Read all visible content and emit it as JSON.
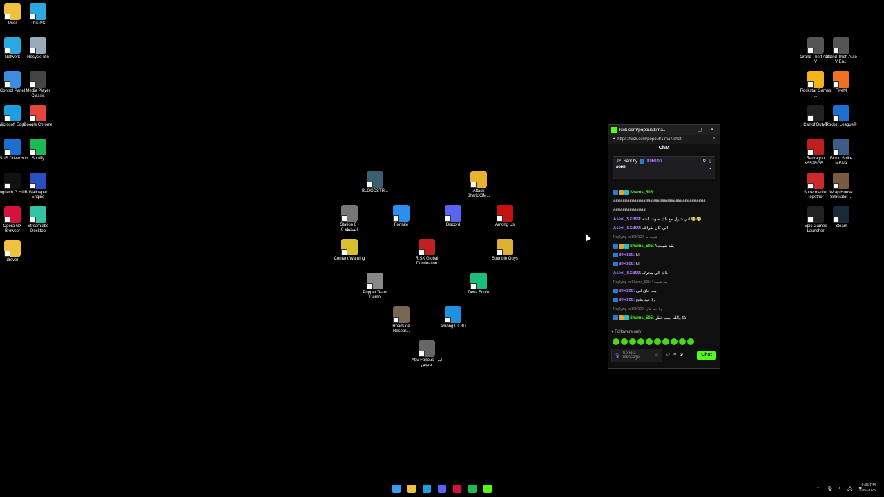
{
  "desktop_left": [
    {
      "label": "User",
      "color": "#f0c040"
    },
    {
      "label": "This PC",
      "color": "#2aa9e0"
    },
    {
      "label": "Network",
      "color": "#2aa9e0"
    },
    {
      "label": "Recycle Bin",
      "color": "#9ab"
    },
    {
      "label": "Control Panel",
      "color": "#3c8de0"
    },
    {
      "label": "Media Player Classic",
      "color": "#444"
    },
    {
      "label": "Microsoft Edge",
      "color": "#1e9de0"
    },
    {
      "label": "Google Chrome",
      "color": "#e4453a"
    },
    {
      "label": "ASUS DriverHub",
      "color": "#1a6fd0"
    },
    {
      "label": "Spotify",
      "color": "#1db954"
    },
    {
      "label": "Logitech G HUB",
      "color": "#111"
    },
    {
      "label": "Wallpaper Engine",
      "color": "#2a4fc0"
    },
    {
      "label": "Opera GX Browser",
      "color": "#d4123c"
    },
    {
      "label": "Streamlabs Desktop",
      "color": "#31c3a2"
    },
    {
      "label": "drover",
      "color": "#f0c040"
    }
  ],
  "desktop_center": [
    {
      "label": "BLOODSTR...",
      "color": "#3a6070"
    },
    {
      "label": "Attack SharkX8M...",
      "color": "#e8b22c"
    },
    {
      "label": "Station 0 - المحطة 0",
      "color": "#777"
    },
    {
      "label": "Fortnite",
      "color": "#2a8ff0"
    },
    {
      "label": "Discord",
      "color": "#5865f2"
    },
    {
      "label": "Among Us",
      "color": "#c51111"
    },
    {
      "label": "Content Warning",
      "color": "#d8c030"
    },
    {
      "label": "RISK Global Domination",
      "color": "#c02020"
    },
    {
      "label": "Stumble Guys",
      "color": "#e0b030"
    },
    {
      "label": "Puppet Team Demo",
      "color": "#888"
    },
    {
      "label": "Delta Force",
      "color": "#1bbf7a"
    },
    {
      "label": "Roadside Resear...",
      "color": "#776655"
    },
    {
      "label": "Among Us 3D",
      "color": "#2090e0"
    },
    {
      "label": "Abu Fanous - ابو فانوس",
      "color": "#666"
    }
  ],
  "desktop_right": [
    {
      "label": "Grand Theft Auto V",
      "color": "#555"
    },
    {
      "label": "Grand Theft Auto V En...",
      "color": "#555"
    },
    {
      "label": "Rockstar Games ...",
      "color": "#f3b41a"
    },
    {
      "label": "FiveM",
      "color": "#f07020"
    },
    {
      "label": "Call of Duty®",
      "color": "#222"
    },
    {
      "label": "Rocket League®",
      "color": "#1f6fd0"
    },
    {
      "label": "Redragon K552RGB...",
      "color": "#c21e1e"
    },
    {
      "label": "Blood Strike MENA",
      "color": "#3e5c88"
    },
    {
      "label": "Supermarket Together",
      "color": "#d02828"
    },
    {
      "label": "Wrap House Simulator ...",
      "color": "#7a5a40"
    },
    {
      "label": "Epic Games Launcher",
      "color": "#222"
    },
    {
      "label": "Steam",
      "color": "#1b2838"
    }
  ],
  "popup": {
    "title": "kick.com/popout/1ima...",
    "url": "https://kick.com/popout/1ima7/chat",
    "chat_header": "Chat",
    "pinned": {
      "sent_by": "Sent by",
      "user": "89H100",
      "text": "89H1"
    },
    "messages": [
      {
        "user": "Shams_505:",
        "text": "",
        "user_color": "green",
        "badges": true
      },
      {
        "user": "",
        "text": "########################################",
        "user_color": "none"
      },
      {
        "user": "",
        "text": "##############",
        "user_color": "none"
      },
      {
        "user": "Aseel_SXB99:",
        "text": "اني جيرل مع ناك صوت انحه 😂😂",
        "user_color": "purple"
      },
      {
        "user": "Aseel_SXB99:",
        "text": "الي كان يقرانك",
        "user_color": "purple"
      },
      {
        "reply": "Replying to 89H100: شبيت يد"
      },
      {
        "user": "Shams_505:",
        "text": "يقد شبيت؟",
        "user_color": "green",
        "badges": true
      },
      {
        "user": "89H100:",
        "text": "انا",
        "user_color": "purple"
      },
      {
        "user": "89H100:",
        "text": "انا",
        "user_color": "purple"
      },
      {
        "user": "Aseel_SXB99:",
        "text": "ذاك الي يتحرك",
        "user_color": "purple"
      },
      {
        "reply": "Replying to Shams_505: يقد شبيت؟"
      },
      {
        "user": "89H100:",
        "text": "يب حاي لتي",
        "user_color": "purple"
      },
      {
        "user": "89H100:",
        "text": "ولا حيد هاتج",
        "user_color": "purple"
      },
      {
        "reply": "Replying to 89H100: ولا حيد هاتج"
      },
      {
        "user": "Shams_505:",
        "text": "لالا والله ابيب قطر",
        "user_color": "green",
        "badges": true
      }
    ],
    "followers_only": "Followers only",
    "input_placeholder": "Send a message",
    "chat_button": "Chat"
  },
  "taskbar": {
    "apps": [
      {
        "name": "start",
        "color": "#3a9af0"
      },
      {
        "name": "file-explorer",
        "color": "#f0c040"
      },
      {
        "name": "edge",
        "color": "#1e9de0"
      },
      {
        "name": "discord",
        "color": "#5865f2"
      },
      {
        "name": "opera",
        "color": "#d4123c"
      },
      {
        "name": "spotify",
        "color": "#1db954"
      },
      {
        "name": "kick",
        "color": "#53fc18"
      }
    ],
    "time": "9:35 PM",
    "date": "12/5/2025"
  }
}
